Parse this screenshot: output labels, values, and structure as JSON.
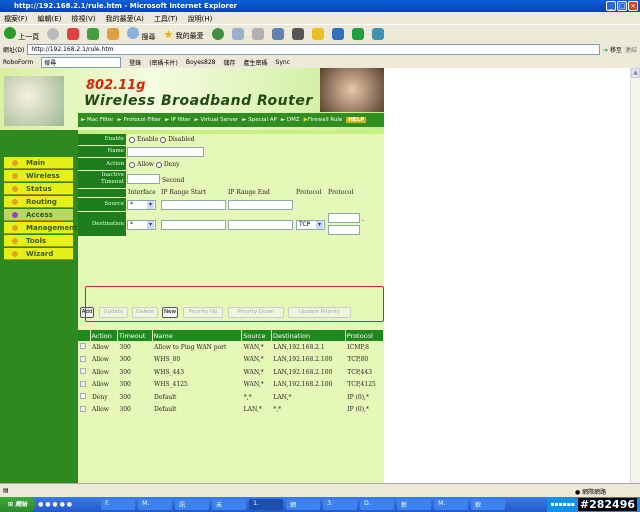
{
  "window": {
    "title": "http://192.168.2.1/rule.htm - Microsoft Internet Explorer"
  },
  "menu": [
    "檔案(F)",
    "編輯(E)",
    "檢視(V)",
    "我的最愛(A)",
    "工具(T)",
    "說明(H)"
  ],
  "toolbar": {
    "back": "上一頁",
    "search": "搜尋",
    "favorites": "我的最愛"
  },
  "address": {
    "label": "網址(D)",
    "url": "http://192.168.2.1/rule.htm",
    "go": "移至",
    "links": "連結"
  },
  "links_bar": {
    "roboform": "RoboForm",
    "search": "搜尋",
    "login": "登錄",
    "passcards": "(密碼卡片)",
    "user": "Boyes828",
    "save": "儲存",
    "generate": "產生密碼",
    "sync": "Sync"
  },
  "banner": {
    "line1": "802.11g",
    "line2": "Wireless Broadband Router",
    "nav": [
      "Mac Filter",
      "Protocol Filter",
      "IP filter",
      "Virtual Server",
      "Special AP",
      "DMZ",
      "Firewall Rule"
    ],
    "help": "HELP"
  },
  "sidebar": [
    {
      "label": "Main"
    },
    {
      "label": "Wireless"
    },
    {
      "label": "Status"
    },
    {
      "label": "Routing"
    },
    {
      "label": "Access",
      "active": true
    },
    {
      "label": "Management"
    },
    {
      "label": "Tools"
    },
    {
      "label": "Wizard"
    }
  ],
  "form": {
    "enable_label": "Enable",
    "enable_opt": "Enable",
    "disabled_opt": "Disabled",
    "name_label": "Name",
    "name_value": "",
    "action_label": "Action",
    "allow_opt": "Allow",
    "deny_opt": "Deny",
    "timeout_label": "Inactive Timeout",
    "timeout_unit": "Second",
    "col_interface": "Interface",
    "col_start": "IP Range Start",
    "col_end": "IP Range End",
    "col_protocol": "Protocol",
    "col_protocol2": "Protocol",
    "source_label": "Source",
    "source_iface": "*",
    "dest_label": "Destination",
    "dest_iface": "*",
    "dest_protocol": "TCP",
    "port_sep": "-"
  },
  "buttons": {
    "add": "Add",
    "update": "Update",
    "delete": "Delete",
    "new": "New",
    "up": "Priority Up",
    "down": "Priority Down",
    "upd_priority": "Update Priority"
  },
  "table": {
    "headers": [
      "Action",
      "Timeout",
      "Name",
      "Source",
      "Destination",
      "Protocol"
    ],
    "rows": [
      [
        "Allow",
        "300",
        "Allow to Ping WAN port",
        "WAN,*",
        "LAN,192.168.2.1",
        "ICMP,8"
      ],
      [
        "Allow",
        "300",
        "WHS_80",
        "WAN,*",
        "LAN,192.168.2.100",
        "TCP,80"
      ],
      [
        "Allow",
        "300",
        "WHS_443",
        "WAN,*",
        "LAN,192.168.2.100",
        "TCP,443"
      ],
      [
        "Allow",
        "300",
        "WHS_4125",
        "WAN,*",
        "LAN,192.168.2.100",
        "TCP,4125"
      ],
      [
        "Deny",
        "300",
        "Default",
        "*,*",
        "LAN,*",
        "IP (0),*"
      ],
      [
        "Allow",
        "300",
        "Default",
        "LAN,*",
        "*,*",
        "IP (0),*"
      ]
    ]
  },
  "status": {
    "zone": "網際網路"
  },
  "taskbar": {
    "start": "開始",
    "tasks": [
      "F.",
      "M.",
      "訊",
      "未",
      "1.",
      "網",
      "3.",
      "D.",
      "新",
      "M.",
      "軟"
    ],
    "watermark": "#282496"
  }
}
